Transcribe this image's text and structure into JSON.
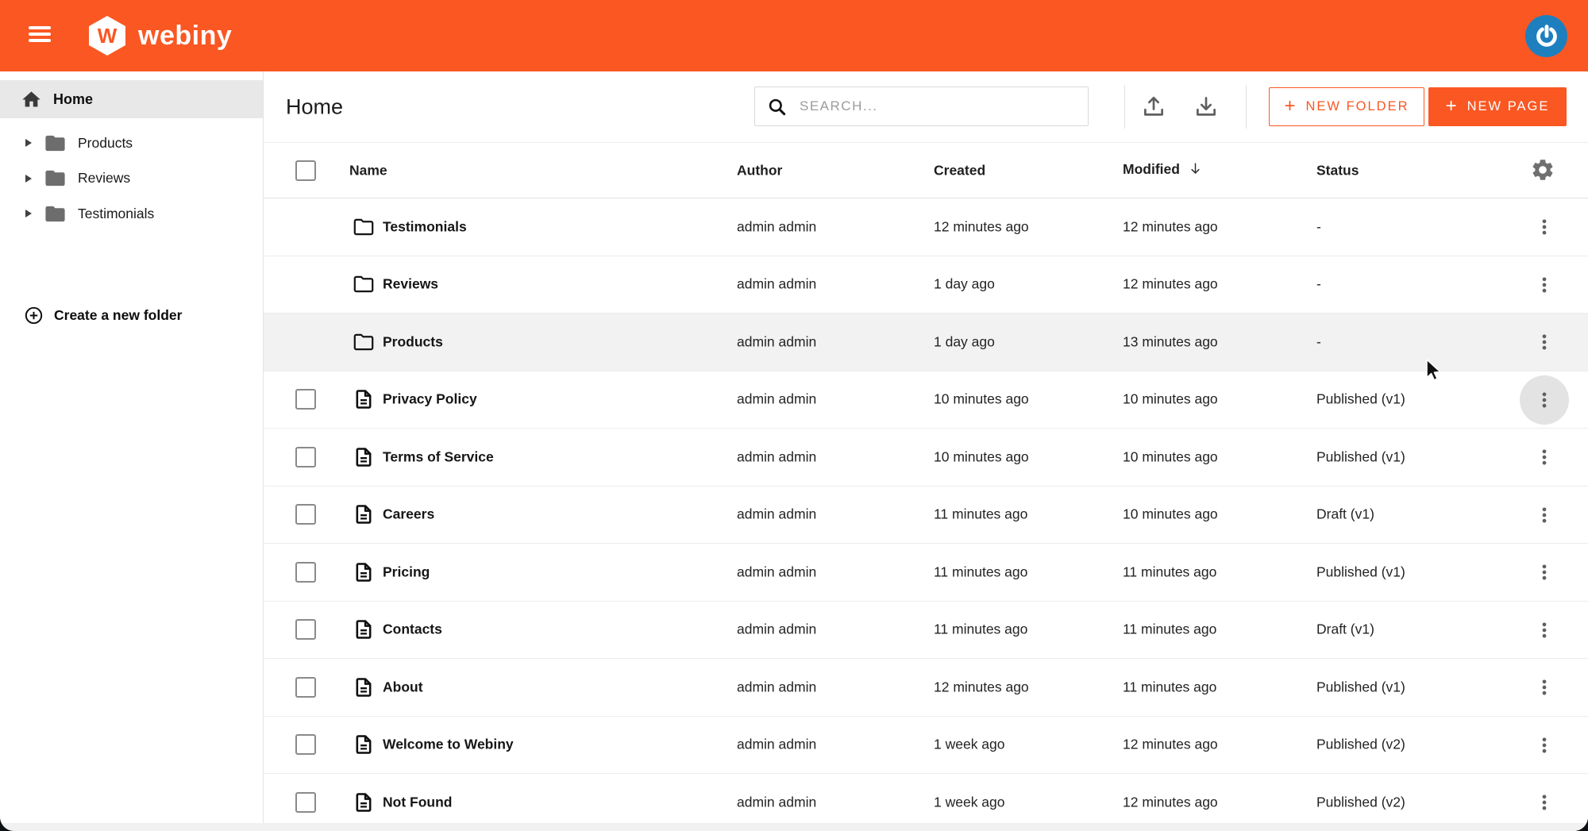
{
  "header": {
    "brand": {
      "logo_letter": "W",
      "wordmark": "webiny"
    }
  },
  "sidebar": {
    "home_label": "Home",
    "folders": [
      {
        "label": "Products"
      },
      {
        "label": "Reviews"
      },
      {
        "label": "Testimonials"
      }
    ],
    "create_label": "Create a new folder"
  },
  "toolbar": {
    "title": "Home",
    "search_placeholder": "SEARCH...",
    "plus_glyph": "+",
    "new_folder_label": "NEW FOLDER",
    "new_page_label": "NEW PAGE"
  },
  "table": {
    "columns": {
      "name": "Name",
      "author": "Author",
      "created": "Created",
      "modified": "Modified",
      "status": "Status"
    },
    "sort": {
      "column": "Modified",
      "direction": "desc"
    },
    "rows": [
      {
        "type": "folder",
        "name": "Testimonials",
        "author": "admin admin",
        "created": "12 minutes ago",
        "modified": "12 minutes ago",
        "status": "-"
      },
      {
        "type": "folder",
        "name": "Reviews",
        "author": "admin admin",
        "created": "1 day ago",
        "modified": "12 minutes ago",
        "status": "-"
      },
      {
        "type": "folder",
        "name": "Products",
        "author": "admin admin",
        "created": "1 day ago",
        "modified": "13 minutes ago",
        "status": "-",
        "state": "hover"
      },
      {
        "type": "page",
        "name": "Privacy Policy",
        "author": "admin admin",
        "created": "10 minutes ago",
        "modified": "10 minutes ago",
        "status": "Published (v1)",
        "menu_highlight": true
      },
      {
        "type": "page",
        "name": "Terms of Service",
        "author": "admin admin",
        "created": "10 minutes ago",
        "modified": "10 minutes ago",
        "status": "Published (v1)"
      },
      {
        "type": "page",
        "name": "Careers",
        "author": "admin admin",
        "created": "11 minutes ago",
        "modified": "10 minutes ago",
        "status": "Draft (v1)"
      },
      {
        "type": "page",
        "name": "Pricing",
        "author": "admin admin",
        "created": "11 minutes ago",
        "modified": "11 minutes ago",
        "status": "Published (v1)"
      },
      {
        "type": "page",
        "name": "Contacts",
        "author": "admin admin",
        "created": "11 minutes ago",
        "modified": "11 minutes ago",
        "status": "Draft (v1)"
      },
      {
        "type": "page",
        "name": "About",
        "author": "admin admin",
        "created": "12 minutes ago",
        "modified": "11 minutes ago",
        "status": "Published (v1)"
      },
      {
        "type": "page",
        "name": "Welcome to Webiny",
        "author": "admin admin",
        "created": "1 week ago",
        "modified": "12 minutes ago",
        "status": "Published (v2)"
      },
      {
        "type": "page",
        "name": "Not Found",
        "author": "admin admin",
        "created": "1 week ago",
        "modified": "12 minutes ago",
        "status": "Published (v2)"
      }
    ]
  },
  "colors": {
    "brand_orange": "#FA5723",
    "avatar_blue": "#1E7FBF",
    "selected_gray": "#E8E8E8",
    "hover_gray": "#F2F2F2"
  }
}
